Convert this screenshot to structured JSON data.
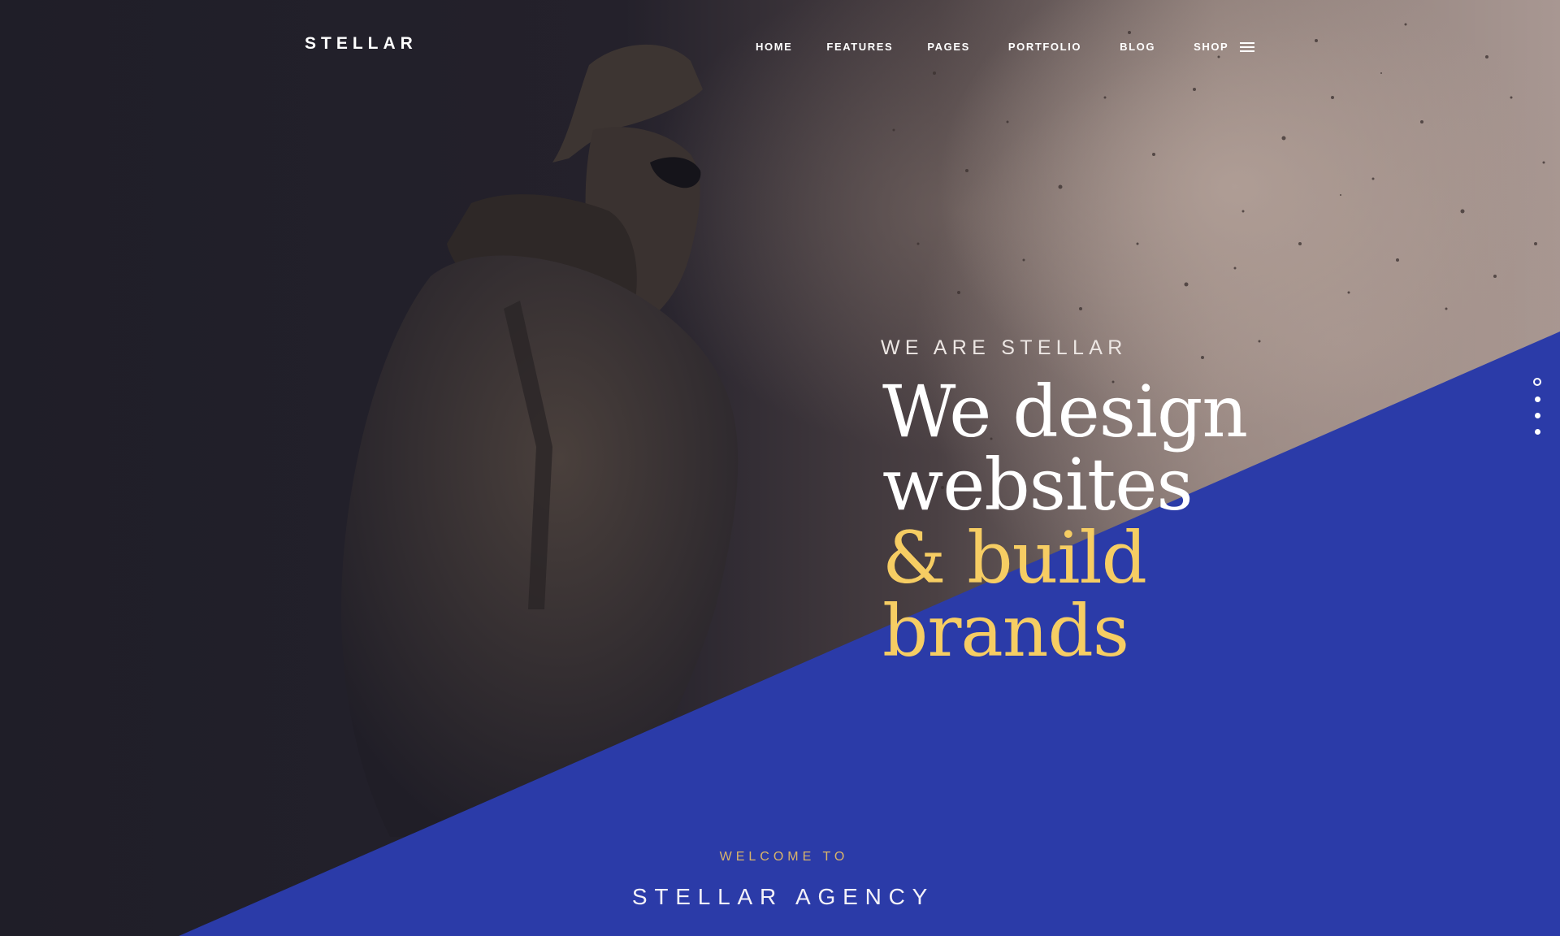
{
  "header": {
    "logo": "STELLAR",
    "nav": {
      "home": "HOME",
      "features": "FEATURES",
      "pages": "PAGES",
      "portfolio": "PORTFOLIO",
      "blog": "BLOG",
      "shop": "SHOP"
    },
    "menu_icon": "hamburger-menu-icon"
  },
  "hero": {
    "eyebrow": "WE ARE STELLAR",
    "headline": {
      "line1": "We design",
      "line2": "websites",
      "line3": "& build",
      "line4": "brands"
    },
    "slides": {
      "count": 4,
      "active_index": 0
    }
  },
  "welcome": {
    "label": "WELCOME TO",
    "title": "STELLAR AGENCY"
  },
  "colors": {
    "accent_blue": "#2b3ba8",
    "accent_yellow": "#f6cd63",
    "welcome_gold": "#d9b46a",
    "dark_background": "#201f29"
  }
}
